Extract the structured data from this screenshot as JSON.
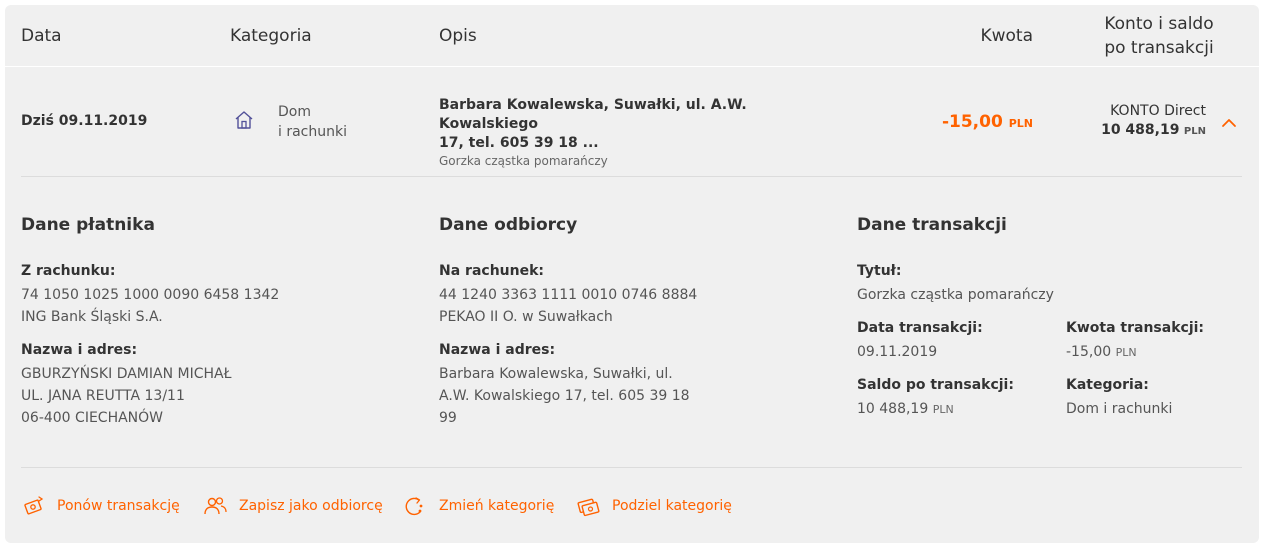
{
  "columns": {
    "date": "Data",
    "category": "Kategoria",
    "description": "Opis",
    "amount": "Kwota",
    "balance_line1": "Konto i saldo",
    "balance_line2": "po transakcji"
  },
  "transaction": {
    "date": "Dziś 09.11.2019",
    "category_icon": "house-icon",
    "category_line1": "Dom",
    "category_line2": "i rachunki",
    "description_line1": "Barbara Kowalewska, Suwałki, ul. A.W. Kowalskiego",
    "description_line2": "17, tel. 605 39 18 ...",
    "description_title": "Gorzka cząstka pomarańczy",
    "amount": "-15,00",
    "amount_currency": "PLN",
    "account_name": "KONTO Direct",
    "balance": "10 488,19",
    "balance_currency": "PLN",
    "toggle_icon": "chevron-up-icon"
  },
  "details": {
    "payer": {
      "title": "Dane płatnika",
      "account_label": "Z rachunku:",
      "account_number": "74 1050 1025 1000 0090 6458 1342",
      "bank": "ING Bank Śląski S.A.",
      "address_label": "Nazwa i adres:",
      "address_line1": "GBURZYŃSKI DAMIAN MICHAŁ",
      "address_line2": "UL. JANA REUTTA 13/11",
      "address_line3": "06-400 CIECHANÓW"
    },
    "recipient": {
      "title": "Dane odbiorcy",
      "account_label": "Na rachunek:",
      "account_number": "44 1240 3363 1111 0010 0746 8884",
      "bank": "PEKAO II O. w Suwałkach",
      "address_label": "Nazwa i adres:",
      "address_line1": "Barbara Kowalewska, Suwałki, ul.",
      "address_line2": "A.W. Kowalskiego 17, tel. 605 39 18",
      "address_line3": "99"
    },
    "transaction": {
      "title": "Dane transakcji",
      "title_label": "Tytuł:",
      "title_value": "Gorzka cząstka pomarańczy",
      "date_label": "Data transakcji:",
      "date_value": "09.11.2019",
      "amount_label": "Kwota transakcji:",
      "amount_value": "-15,00",
      "amount_currency": "PLN",
      "balance_label": "Saldo po transakcji:",
      "balance_value": "10 488,19",
      "balance_currency": "PLN",
      "category_label": "Kategoria:",
      "category_value": "Dom i rachunki"
    }
  },
  "actions": [
    {
      "label": "Ponów transakcję",
      "icon": "repeat-transfer-icon"
    },
    {
      "label": "Zapisz jako odbiorcę",
      "icon": "people-icon"
    },
    {
      "label": "Zmień kategorię",
      "icon": "change-category-icon"
    },
    {
      "label": "Podziel kategorię",
      "icon": "split-category-icon"
    }
  ],
  "colors": {
    "accent": "#ff6200",
    "panel_bg": "#f0f0f0",
    "text": "#333333",
    "icon_blue": "#525199"
  }
}
